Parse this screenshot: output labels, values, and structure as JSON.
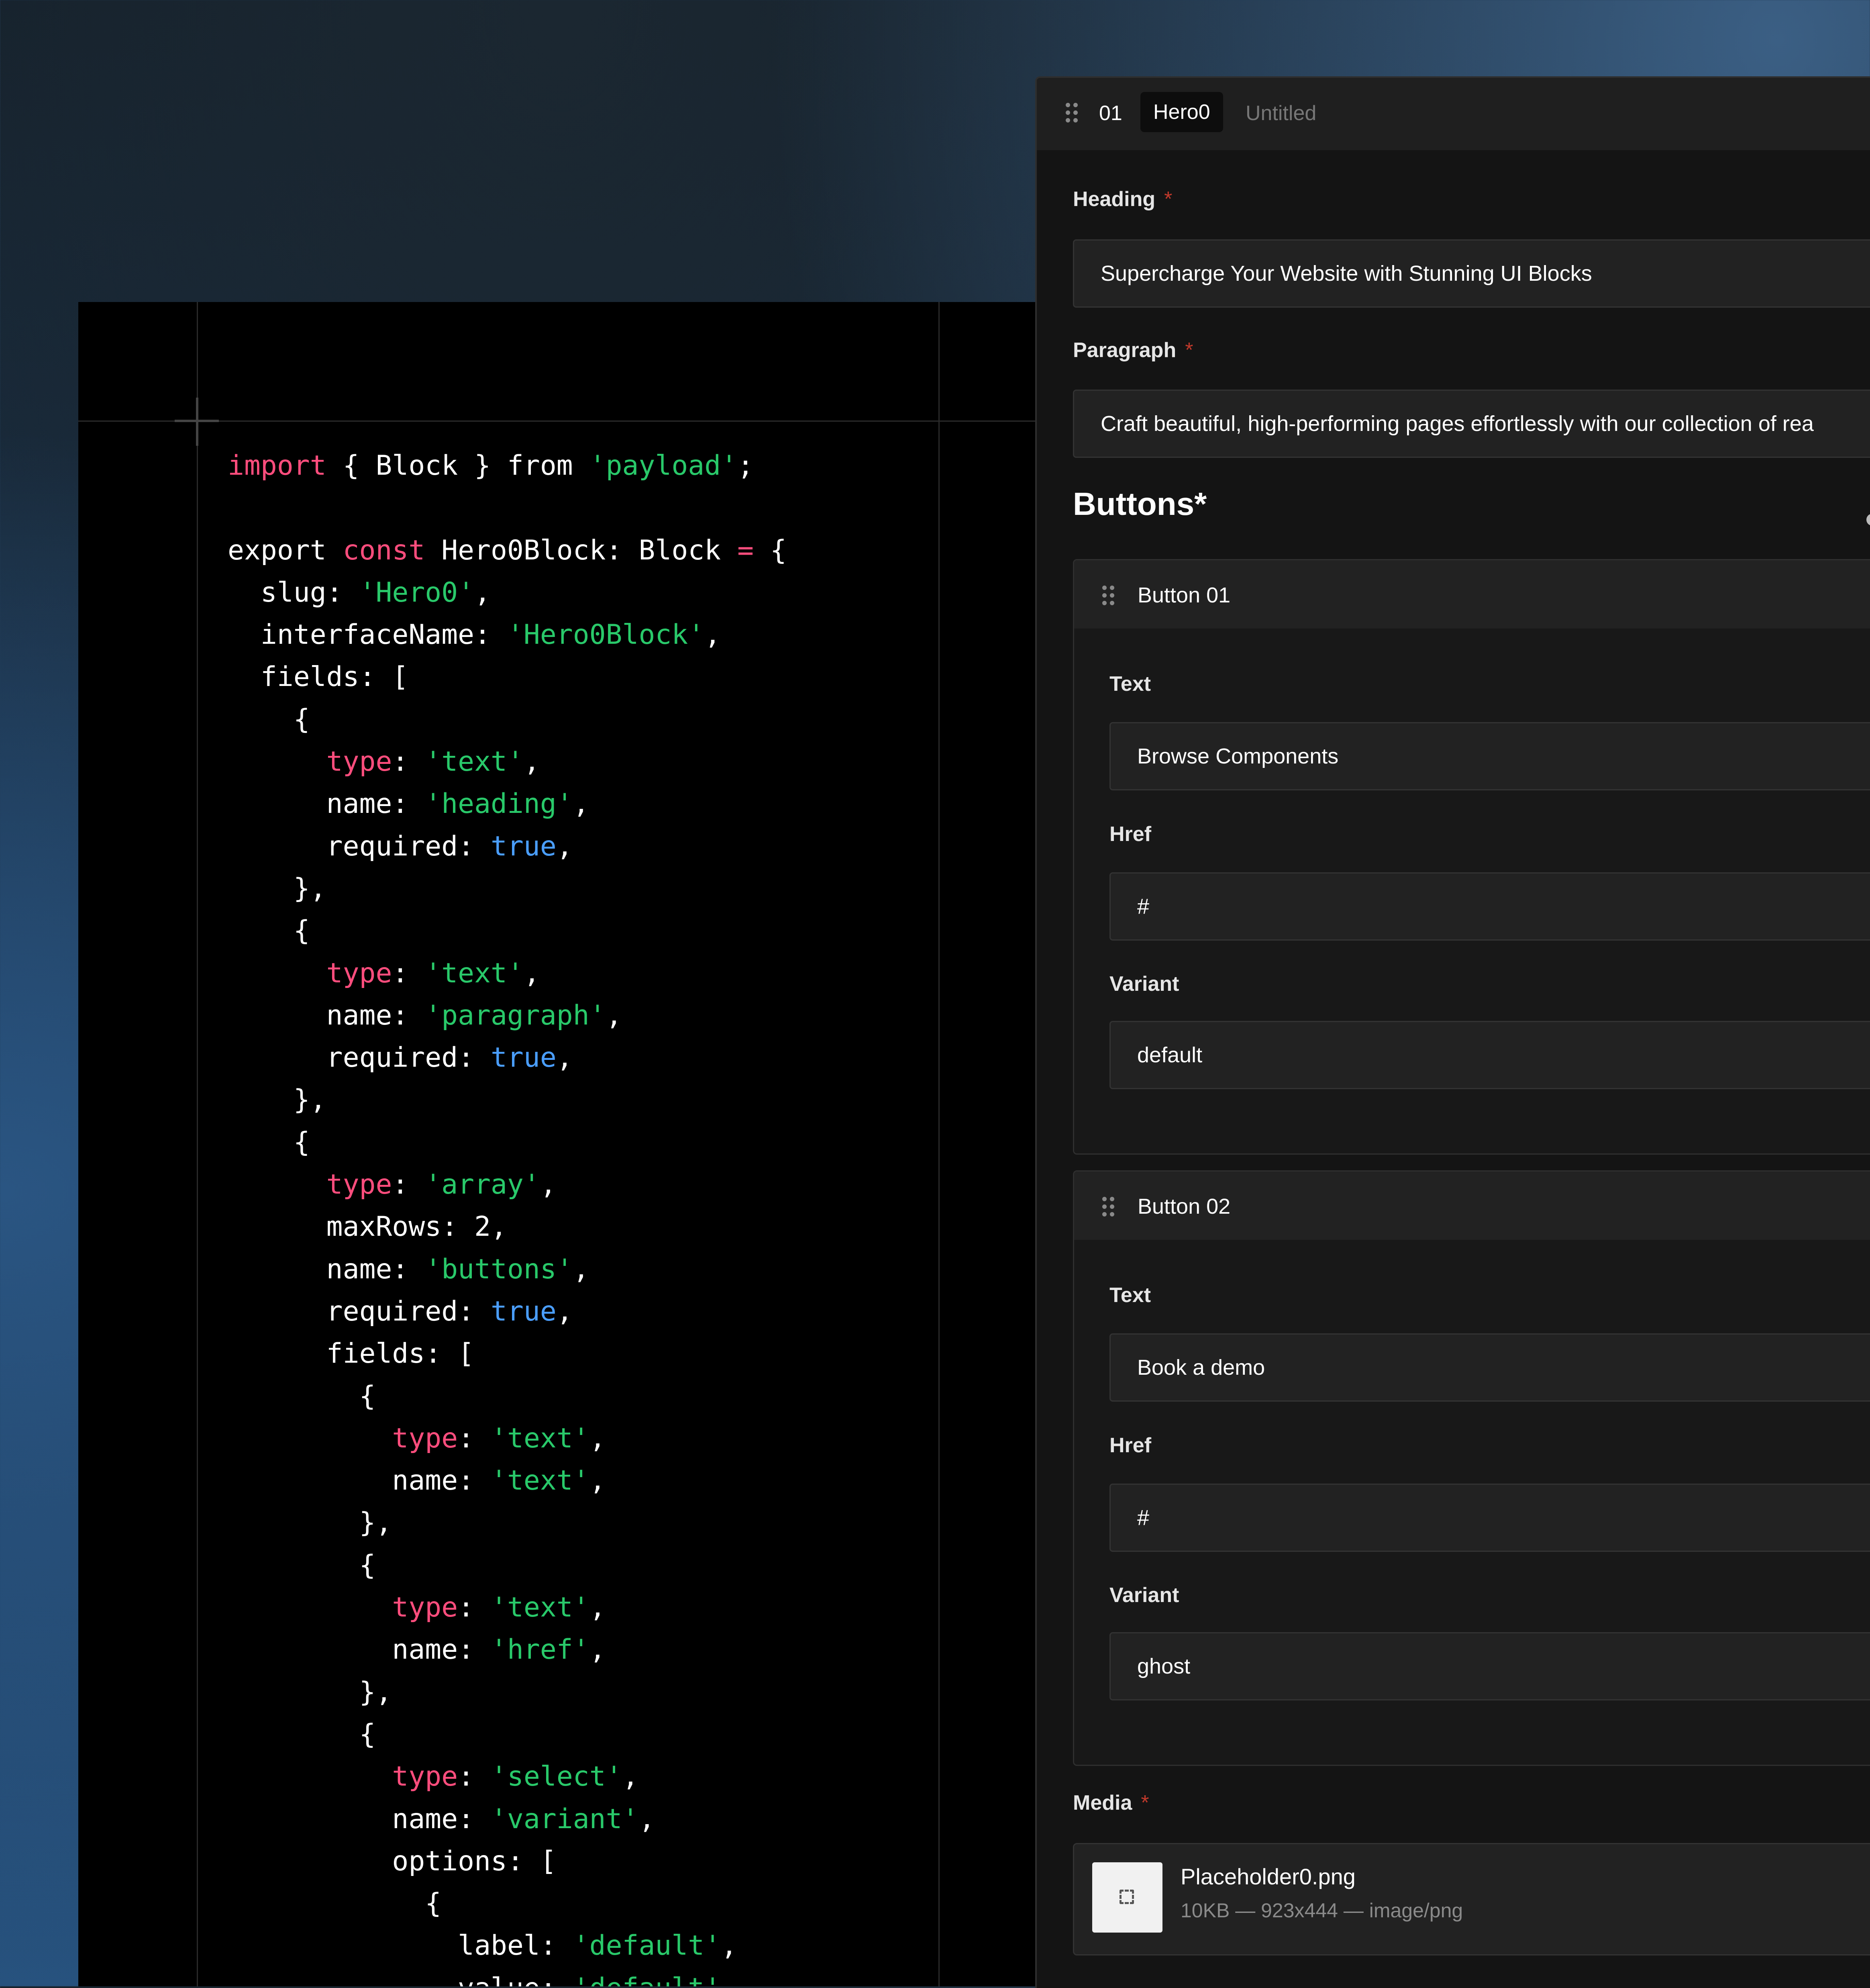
{
  "code": {
    "lines": [
      [
        {
          "t": "import",
          "c": "kw"
        },
        {
          "t": " { Block } from ",
          "c": "p"
        },
        {
          "t": "'payload'",
          "c": "str"
        },
        {
          "t": ";",
          "c": "p"
        }
      ],
      [],
      [
        {
          "t": "export ",
          "c": "p"
        },
        {
          "t": "const",
          "c": "kw"
        },
        {
          "t": " Hero0Block: Block ",
          "c": "p"
        },
        {
          "t": "=",
          "c": "kw"
        },
        {
          "t": " {",
          "c": "p"
        }
      ],
      [
        {
          "t": "  slug: ",
          "c": "p"
        },
        {
          "t": "'Hero0'",
          "c": "str"
        },
        {
          "t": ",",
          "c": "p"
        }
      ],
      [
        {
          "t": "  interfaceName: ",
          "c": "p"
        },
        {
          "t": "'Hero0Block'",
          "c": "str"
        },
        {
          "t": ",",
          "c": "p"
        }
      ],
      [
        {
          "t": "  fields: [",
          "c": "p"
        }
      ],
      [
        {
          "t": "    {",
          "c": "p"
        }
      ],
      [
        {
          "t": "      ",
          "c": "p"
        },
        {
          "t": "type",
          "c": "kw"
        },
        {
          "t": ": ",
          "c": "p"
        },
        {
          "t": "'text'",
          "c": "str"
        },
        {
          "t": ",",
          "c": "p"
        }
      ],
      [
        {
          "t": "      name: ",
          "c": "p"
        },
        {
          "t": "'heading'",
          "c": "str"
        },
        {
          "t": ",",
          "c": "p"
        }
      ],
      [
        {
          "t": "      required: ",
          "c": "p"
        },
        {
          "t": "true",
          "c": "bool"
        },
        {
          "t": ",",
          "c": "p"
        }
      ],
      [
        {
          "t": "    },",
          "c": "p"
        }
      ],
      [
        {
          "t": "    {",
          "c": "p"
        }
      ],
      [
        {
          "t": "      ",
          "c": "p"
        },
        {
          "t": "type",
          "c": "kw"
        },
        {
          "t": ": ",
          "c": "p"
        },
        {
          "t": "'text'",
          "c": "str"
        },
        {
          "t": ",",
          "c": "p"
        }
      ],
      [
        {
          "t": "      name: ",
          "c": "p"
        },
        {
          "t": "'paragraph'",
          "c": "str"
        },
        {
          "t": ",",
          "c": "p"
        }
      ],
      [
        {
          "t": "      required: ",
          "c": "p"
        },
        {
          "t": "true",
          "c": "bool"
        },
        {
          "t": ",",
          "c": "p"
        }
      ],
      [
        {
          "t": "    },",
          "c": "p"
        }
      ],
      [
        {
          "t": "    {",
          "c": "p"
        }
      ],
      [
        {
          "t": "      ",
          "c": "p"
        },
        {
          "t": "type",
          "c": "kw"
        },
        {
          "t": ": ",
          "c": "p"
        },
        {
          "t": "'array'",
          "c": "str"
        },
        {
          "t": ",",
          "c": "p"
        }
      ],
      [
        {
          "t": "      maxRows: 2,",
          "c": "p"
        }
      ],
      [
        {
          "t": "      name: ",
          "c": "p"
        },
        {
          "t": "'buttons'",
          "c": "str"
        },
        {
          "t": ",",
          "c": "p"
        }
      ],
      [
        {
          "t": "      required: ",
          "c": "p"
        },
        {
          "t": "true",
          "c": "bool"
        },
        {
          "t": ",",
          "c": "p"
        }
      ],
      [
        {
          "t": "      fields: [",
          "c": "p"
        }
      ],
      [
        {
          "t": "        {",
          "c": "p"
        }
      ],
      [
        {
          "t": "          ",
          "c": "p"
        },
        {
          "t": "type",
          "c": "kw"
        },
        {
          "t": ": ",
          "c": "p"
        },
        {
          "t": "'text'",
          "c": "str"
        },
        {
          "t": ",",
          "c": "p"
        }
      ],
      [
        {
          "t": "          name: ",
          "c": "p"
        },
        {
          "t": "'text'",
          "c": "str"
        },
        {
          "t": ",",
          "c": "p"
        }
      ],
      [
        {
          "t": "        },",
          "c": "p"
        }
      ],
      [
        {
          "t": "        {",
          "c": "p"
        }
      ],
      [
        {
          "t": "          ",
          "c": "p"
        },
        {
          "t": "type",
          "c": "kw"
        },
        {
          "t": ": ",
          "c": "p"
        },
        {
          "t": "'text'",
          "c": "str"
        },
        {
          "t": ",",
          "c": "p"
        }
      ],
      [
        {
          "t": "          name: ",
          "c": "p"
        },
        {
          "t": "'href'",
          "c": "str"
        },
        {
          "t": ",",
          "c": "p"
        }
      ],
      [
        {
          "t": "        },",
          "c": "p"
        }
      ],
      [
        {
          "t": "        {",
          "c": "p"
        }
      ],
      [
        {
          "t": "          ",
          "c": "p"
        },
        {
          "t": "type",
          "c": "kw"
        },
        {
          "t": ": ",
          "c": "p"
        },
        {
          "t": "'select'",
          "c": "str"
        },
        {
          "t": ",",
          "c": "p"
        }
      ],
      [
        {
          "t": "          name: ",
          "c": "p"
        },
        {
          "t": "'variant'",
          "c": "str"
        },
        {
          "t": ",",
          "c": "p"
        }
      ],
      [
        {
          "t": "          options: [",
          "c": "p"
        }
      ],
      [
        {
          "t": "            {",
          "c": "p"
        }
      ],
      [
        {
          "t": "              label: ",
          "c": "p"
        },
        {
          "t": "'default'",
          "c": "str"
        },
        {
          "t": ",",
          "c": "p"
        }
      ],
      [
        {
          "t": "              value: ",
          "c": "p"
        },
        {
          "t": "'default'",
          "c": "str"
        },
        {
          "t": ",",
          "c": "p"
        }
      ]
    ]
  },
  "form": {
    "header": {
      "index": "01",
      "block_label": "Hero0",
      "title": "Untitled"
    },
    "heading": {
      "label": "Heading",
      "required_mark": "*",
      "value": "Supercharge Your Website with Stunning UI Blocks"
    },
    "paragraph": {
      "label": "Paragraph",
      "required_mark": "*",
      "value": "Craft beautiful, high-performing pages effortlessly with our collection of rea"
    },
    "buttons_section": {
      "title": "Buttons*"
    },
    "buttons": [
      {
        "title": "Button 01",
        "text_label": "Text",
        "text_value": "Browse Components",
        "href_label": "Href",
        "href_value": "#",
        "variant_label": "Variant",
        "variant_value": "default"
      },
      {
        "title": "Button 02",
        "text_label": "Text",
        "text_value": "Book a demo",
        "href_label": "Href",
        "href_value": "#",
        "variant_label": "Variant",
        "variant_value": "ghost"
      }
    ],
    "media": {
      "label": "Media",
      "required_mark": "*",
      "filename": "Placeholder0.png",
      "meta": "10KB — 923x444 — image/png"
    }
  },
  "colors": {
    "keyword": "#ff4d7d",
    "string": "#29c96a",
    "boolean": "#4a9eff",
    "required": "#c0392b"
  },
  "icons": {
    "drag_handle": "drag-handle-icon",
    "thumbnail": "image-placeholder-icon"
  }
}
